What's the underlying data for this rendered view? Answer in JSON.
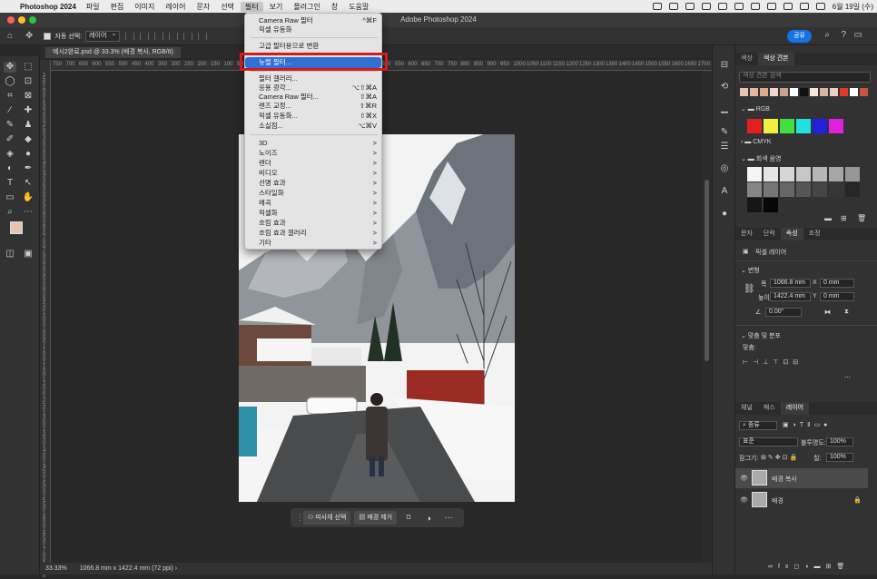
{
  "menubar": {
    "app_name": "Photoshop 2024",
    "items": [
      "파일",
      "편집",
      "이미지",
      "레이어",
      "문자",
      "선택",
      "필터",
      "보기",
      "플러그인",
      "창",
      "도움말"
    ],
    "active_item": "필터",
    "clock": "6월 19일 (수)"
  },
  "titlebar": {
    "title": "Adobe Photoshop 2024"
  },
  "options": {
    "auto_select_label": "자동 선택:",
    "auto_select_value": "레이어",
    "share_label": "공유"
  },
  "document": {
    "tab": "예시2완료.psd @ 33.3% (배경 복사, RGB/8)"
  },
  "ruler_top": [
    "750",
    "700",
    "650",
    "600",
    "550",
    "500",
    "450",
    "400",
    "350",
    "300",
    "250",
    "200",
    "150",
    "100",
    "50",
    "0",
    "50",
    "100",
    "150",
    "200",
    "250",
    "300",
    "350",
    "400",
    "450",
    "500",
    "550",
    "600",
    "650",
    "700",
    "750",
    "800",
    "850",
    "900",
    "950",
    "1000",
    "1050",
    "1100",
    "1150",
    "1200",
    "1250",
    "1300",
    "1350",
    "1400",
    "1450",
    "1500",
    "1550",
    "1600",
    "1650",
    "1700",
    "1750"
  ],
  "ruler_left": [
    "1",
    "5",
    "0",
    "1",
    "0",
    "0",
    "1",
    "5",
    "0",
    "2",
    "0",
    "0",
    "2",
    "5",
    "0",
    "3",
    "0",
    "0",
    "3",
    "5",
    "0",
    "4",
    "0",
    "0",
    "4",
    "5",
    "0",
    "5",
    "0",
    "0",
    "5",
    "5",
    "0",
    "6",
    "0",
    "0",
    "6",
    "5",
    "0",
    "7",
    "0",
    "0",
    "7",
    "5",
    "0",
    "8",
    "0",
    "0",
    "8",
    "5",
    "0",
    "9",
    "0",
    "0",
    "9",
    "5",
    "0",
    "1",
    "0",
    "0",
    "0",
    "1",
    "0",
    "5",
    "0",
    "1",
    "1",
    "0",
    "0",
    "1",
    "1",
    "5",
    "0",
    "1",
    "2",
    "0",
    "0",
    "1",
    "2",
    "5",
    "0",
    "1",
    "3",
    "0",
    "0",
    "1",
    "3",
    "5",
    "0",
    "1",
    "4",
    "0",
    "0",
    "1",
    "4",
    "5",
    "0",
    "1",
    "5",
    "0",
    "0",
    "1",
    "5",
    "5",
    "0",
    "1",
    "6",
    "0",
    "0",
    "1",
    "6",
    "5",
    "0",
    "1",
    "7",
    "0",
    "0",
    "1",
    "7",
    "5",
    "0"
  ],
  "filter_menu": {
    "items": [
      {
        "label": "Camera Raw 필터",
        "shortcut": "^⌘F"
      },
      {
        "label": "픽셀 유동화",
        "shortcut": ""
      },
      {
        "label": "고급 필터용으로 변환",
        "shortcut": ""
      },
      {
        "label": "뉴럴 필터...",
        "shortcut": ""
      },
      {
        "label": "필터 갤러리...",
        "shortcut": ""
      },
      {
        "label": "응용 광각...",
        "shortcut": "⌥⇧⌘A"
      },
      {
        "label": "Camera Raw 필터...",
        "shortcut": "⇧⌘A"
      },
      {
        "label": "렌즈 교정...",
        "shortcut": "⇧⌘R"
      },
      {
        "label": "픽셀 유동화...",
        "shortcut": "⇧⌘X"
      },
      {
        "label": "소실점...",
        "shortcut": "⌥⌘V"
      },
      {
        "label": "3D",
        "shortcut": ">"
      },
      {
        "label": "노이즈",
        "shortcut": ">"
      },
      {
        "label": "렌더",
        "shortcut": ">"
      },
      {
        "label": "비디오",
        "shortcut": ">"
      },
      {
        "label": "선명 효과",
        "shortcut": ">"
      },
      {
        "label": "스타일화",
        "shortcut": ">"
      },
      {
        "label": "왜곡",
        "shortcut": ">"
      },
      {
        "label": "픽셀화",
        "shortcut": ">"
      },
      {
        "label": "흐림 효과",
        "shortcut": ">"
      },
      {
        "label": "흐림 효과 갤러리",
        "shortcut": ">"
      },
      {
        "label": "기타",
        "shortcut": ">"
      }
    ],
    "highlighted": "뉴럴 필터..."
  },
  "context_bar": {
    "select_subject": "피사체 선택",
    "remove_bg": "배경 제거"
  },
  "status": {
    "zoom": "33.33%",
    "info": "1066.8 mm x 1422.4 mm (72 ppi)"
  },
  "color_panel": {
    "tabs": [
      "색상",
      "색상 견본"
    ],
    "search_placeholder": "색상 견본 검색",
    "groups": [
      "RGB",
      "CMYK",
      "회색 음영"
    ],
    "recent_colors": [
      "#e7c4ae",
      "#e2b99e",
      "#d9a98c",
      "#f0d8c8",
      "#c9a38b",
      "#ffffff",
      "#111111",
      "#f6e6dc",
      "#d7b7a3",
      "#ead0c0",
      "#e03a2a",
      "#ffffff",
      "#c9563c"
    ],
    "rgb_colors": [
      "#e02020",
      "#f0f040",
      "#40e040",
      "#20e0e0",
      "#2020e0",
      "#e020e0"
    ],
    "gray_colors": [
      "#f5f5f5",
      "#e6e6e6",
      "#d6d6d6",
      "#c6c6c6",
      "#b6b6b6",
      "#a6a6a6",
      "#969696",
      "#868686",
      "#767676",
      "#666666",
      "#565656",
      "#464646",
      "#363636",
      "#262626",
      "#161616",
      "#060606"
    ]
  },
  "properties_panel": {
    "tabs": [
      "문자",
      "단락",
      "속성",
      "조정"
    ],
    "layer_type": "픽셀 레이어",
    "transform_label": "변형",
    "width_label": "폭",
    "width_value": "1066.8 mm",
    "height_label": "높이",
    "height_value": "1422.4 mm",
    "x_label": "X",
    "x_value": "0 mm",
    "y_label": "Y",
    "y_value": "0 mm",
    "angle_value": "0.00°",
    "align_label": "맞춤 및 분포",
    "align_sub": "맞춤:"
  },
  "layers_panel": {
    "tabs": [
      "채널",
      "패스",
      "레이어"
    ],
    "kind": "종류",
    "blend_mode": "표준",
    "opacity_label": "불투명도:",
    "opacity_value": "100%",
    "lock_label": "잠그기:",
    "fill_label": "칠:",
    "fill_value": "100%",
    "layers": [
      {
        "name": "배경 복사",
        "selected": true
      },
      {
        "name": "배경",
        "selected": false,
        "locked": true
      }
    ]
  }
}
